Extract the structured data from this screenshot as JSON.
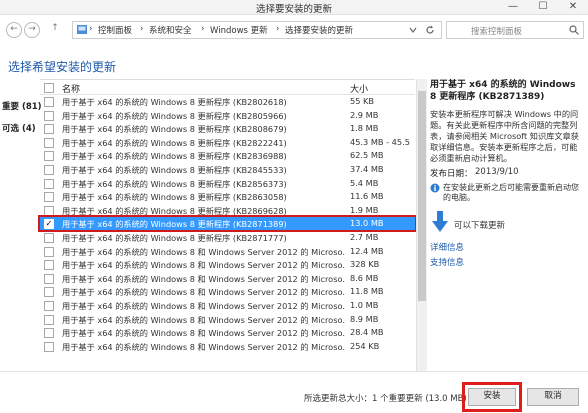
{
  "window": {
    "title": "选择要安装的更新",
    "minimize": "—",
    "maximize": "☐",
    "close": "✕"
  },
  "nav": {
    "back": "←",
    "forward": "→",
    "up": "↑"
  },
  "address": {
    "segments": [
      "控制面板",
      "系统和安全",
      "Windows 更新",
      "选择要安装的更新"
    ],
    "separator": "›"
  },
  "search": {
    "placeholder": "搜索控制面板"
  },
  "heading": "选择希望安装的更新",
  "categories": [
    {
      "label": "重要 (81)"
    },
    {
      "label": "可选 (4)"
    }
  ],
  "columns": {
    "name": "名称",
    "size": "大小"
  },
  "rows": [
    {
      "name": "用于基于 x64 的系统的 Windows 8 更新程序 (KB2802618)",
      "size": "55 KB",
      "checked": false,
      "selected": false
    },
    {
      "name": "用于基于 x64 的系统的 Windows 8 更新程序 (KB2805966)",
      "size": "2.9 MB",
      "checked": false,
      "selected": false
    },
    {
      "name": "用于基于 x64 的系统的 Windows 8 更新程序 (KB2808679)",
      "size": "1.8 MB",
      "checked": false,
      "selected": false
    },
    {
      "name": "用于基于 x64 的系统的 Windows 8 更新程序 (KB2822241)",
      "size": "45.3 MB - 45.5",
      "checked": false,
      "selected": false
    },
    {
      "name": "用于基于 x64 的系统的 Windows 8 更新程序 (KB2836988)",
      "size": "62.5 MB",
      "checked": false,
      "selected": false
    },
    {
      "name": "用于基于 x64 的系统的 Windows 8 更新程序 (KB2845533)",
      "size": "37.4 MB",
      "checked": false,
      "selected": false
    },
    {
      "name": "用于基于 x64 的系统的 Windows 8 更新程序 (KB2856373)",
      "size": "5.4 MB",
      "checked": false,
      "selected": false
    },
    {
      "name": "用于基于 x64 的系统的 Windows 8 更新程序 (KB2863058)",
      "size": "11.6 MB",
      "checked": false,
      "selected": false
    },
    {
      "name": "用于基于 x64 的系统的 Windows 8 更新程序 (KB2869628)",
      "size": "1.9 MB",
      "checked": false,
      "selected": false
    },
    {
      "name": "用于基于 x64 的系统的 Windows 8 更新程序 (KB2871389)",
      "size": "13.0 MB",
      "checked": true,
      "selected": true
    },
    {
      "name": "用于基于 x64 的系统的 Windows 8 更新程序 (KB2871777)",
      "size": "2.7 MB",
      "checked": false,
      "selected": false
    },
    {
      "name": "用于基于 x64 的系统的 Windows 8 和 Windows Server 2012 的 Microso...",
      "size": "12.4 MB",
      "checked": false,
      "selected": false
    },
    {
      "name": "用于基于 x64 的系统的 Windows 8 和 Windows Server 2012 的 Microso...",
      "size": "328 KB",
      "checked": false,
      "selected": false
    },
    {
      "name": "用于基于 x64 的系统的 Windows 8 和 Windows Server 2012 的 Microso...",
      "size": "8.6 MB",
      "checked": false,
      "selected": false
    },
    {
      "name": "用于基于 x64 的系统的 Windows 8 和 Windows Server 2012 的 Microso...",
      "size": "11.8 MB",
      "checked": false,
      "selected": false
    },
    {
      "name": "用于基于 x64 的系统的 Windows 8 和 Windows Server 2012 的 Microso...",
      "size": "1.0 MB",
      "checked": false,
      "selected": false
    },
    {
      "name": "用于基于 x64 的系统的 Windows 8 和 Windows Server 2012 的 Microso...",
      "size": "8.9 MB",
      "checked": false,
      "selected": false
    },
    {
      "name": "用于基于 x64 的系统的 Windows 8 和 Windows Server 2012 的 Microso...",
      "size": "28.4 MB",
      "checked": false,
      "selected": false
    },
    {
      "name": "用于基于 x64 的系统的 Windows 8 和 Windows Server 2012 的 Microso...",
      "size": "254 KB",
      "checked": false,
      "selected": false
    }
  ],
  "details": {
    "title": "用于基于 x64 的系统的 Windows 8 更新程序 (KB2871389)",
    "description": "安装本更新程序可解决 Windows 中的问题。有关此更新程序中所含问题的完整列表，请参阅相关 Microsoft 知识库文章获取详细信息。安装本更新程序之后，可能必须重新启动计算机。",
    "published_label": "发布日期：",
    "published_value": "2013/9/10",
    "warning": "在安装此更新之后可能需要重新启动您的电脑。",
    "download_ready": "可以下载更新",
    "more_info": "详细信息",
    "support_info": "支持信息"
  },
  "footer": {
    "summary": "所选更新总大小：1 个重要更新 (13.0 MB)",
    "install": "安装",
    "cancel": "取消"
  },
  "colors": {
    "accent": "#3399ff",
    "highlight_border": "#d11a1a",
    "heading": "#1e5aa8"
  }
}
